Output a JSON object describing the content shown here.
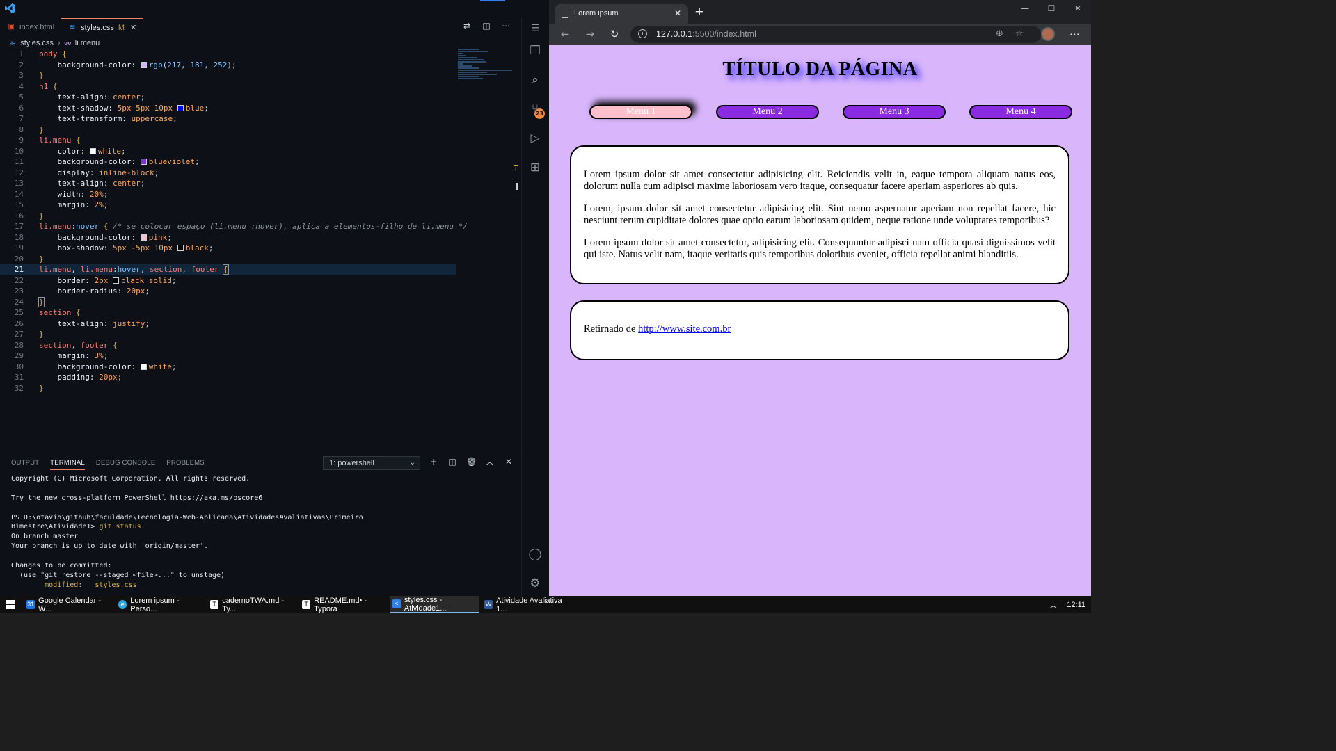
{
  "vscode": {
    "tabs": [
      {
        "label": "index.html",
        "icon": "html-file-icon",
        "active": false
      },
      {
        "label": "styles.css",
        "icon": "css-file-icon",
        "active": true,
        "modified": "M"
      }
    ],
    "breadcrumb": {
      "file": "styles.css",
      "symbol": "li.menu"
    },
    "code_lines": [
      "1",
      "2",
      "3",
      "4",
      "5",
      "6",
      "7",
      "8",
      "9",
      "10",
      "11",
      "12",
      "13",
      "14",
      "15",
      "16",
      "17",
      "18",
      "19",
      "20",
      "21",
      "22",
      "23",
      "24",
      "25",
      "26",
      "27",
      "28",
      "29",
      "30",
      "31",
      "32"
    ],
    "git_badge": "23",
    "panel": {
      "tabs": [
        "OUTPUT",
        "TERMINAL",
        "DEBUG CONSOLE",
        "PROBLEMS"
      ],
      "active_tab": "TERMINAL",
      "terminal_select": "1: powershell",
      "terminal_lines": [
        "Copyright (C) Microsoft Corporation. All rights reserved.",
        "",
        "Try the new cross-platform PowerShell https://aka.ms/pscore6",
        "",
        "PS D:\\otavio\\github\\faculdade\\Tecnologia-Web-Aplicada\\AtividadesAvaliativas\\Primeiro",
        "Bimestre\\Atividade1> ",
        "On branch master",
        "Your branch is up to date with 'origin/master'.",
        "",
        "Changes to be committed:",
        "  (use \"git restore --staged <file>...\" to unstage)",
        "        modified:   styles.css"
      ],
      "command": "git status"
    }
  },
  "browser": {
    "tab_title": "Lorem ipsum",
    "url_host": "127.0.0.1",
    "url_rest": ":5500/index.html",
    "page": {
      "title": "Título da página",
      "menu": [
        "Menu 1",
        "Menu 2",
        "Menu 3",
        "Menu 4"
      ],
      "paragraphs": [
        "Lorem ipsum dolor sit amet consectetur adipisicing elit. Reiciendis velit in, eaque tempora aliquam natus eos, dolorum nulla cum adipisci maxime laboriosam vero itaque, consequatur facere aperiam asperiores ab quis.",
        "Lorem, ipsum dolor sit amet consectetur adipisicing elit. Sint nemo aspernatur aperiam non repellat facere, hic nesciunt rerum cupiditate dolores quae optio earum laboriosam quidem, neque ratione unde voluptates temporibus?",
        "Lorem ipsum dolor sit amet consectetur, adipisicing elit. Consequuntur adipisci nam officia quasi dignissimos velit qui iste. Natus velit nam, itaque veritatis quis temporibus doloribus eveniet, officia repellat animi blanditiis."
      ],
      "footer_prefix": "Retirnado de ",
      "footer_link": "http://www.site.com.br"
    }
  },
  "taskbar": {
    "items": [
      {
        "label": "Google Calendar - W...",
        "icon": "calendar-icon",
        "color": "#1a73e8",
        "glyph": "31"
      },
      {
        "label": "Lorem ipsum - Perso...",
        "icon": "edge-icon",
        "color": "#2ba9e0",
        "glyph": "e"
      },
      {
        "label": "cadernoTWA.md - Ty...",
        "icon": "typora-icon",
        "color": "#ffffff",
        "glyph": "T"
      },
      {
        "label": "README.md• - Typora",
        "icon": "typora-icon",
        "color": "#ffffff",
        "glyph": "T"
      },
      {
        "label": "styles.css - Atividade1...",
        "icon": "vscode-icon",
        "color": "#2f80ed",
        "glyph": "<"
      },
      {
        "label": "Atividade Avaliativa 1...",
        "icon": "word-icon",
        "color": "#2b579a",
        "glyph": "W"
      }
    ],
    "clock": "12:11"
  },
  "colors": {
    "page_bg": "#d9b5fc",
    "menu_bg": "#8a2be2",
    "menu_hover_bg": "#ffc0cb",
    "vscode_bg": "#0d1117"
  }
}
